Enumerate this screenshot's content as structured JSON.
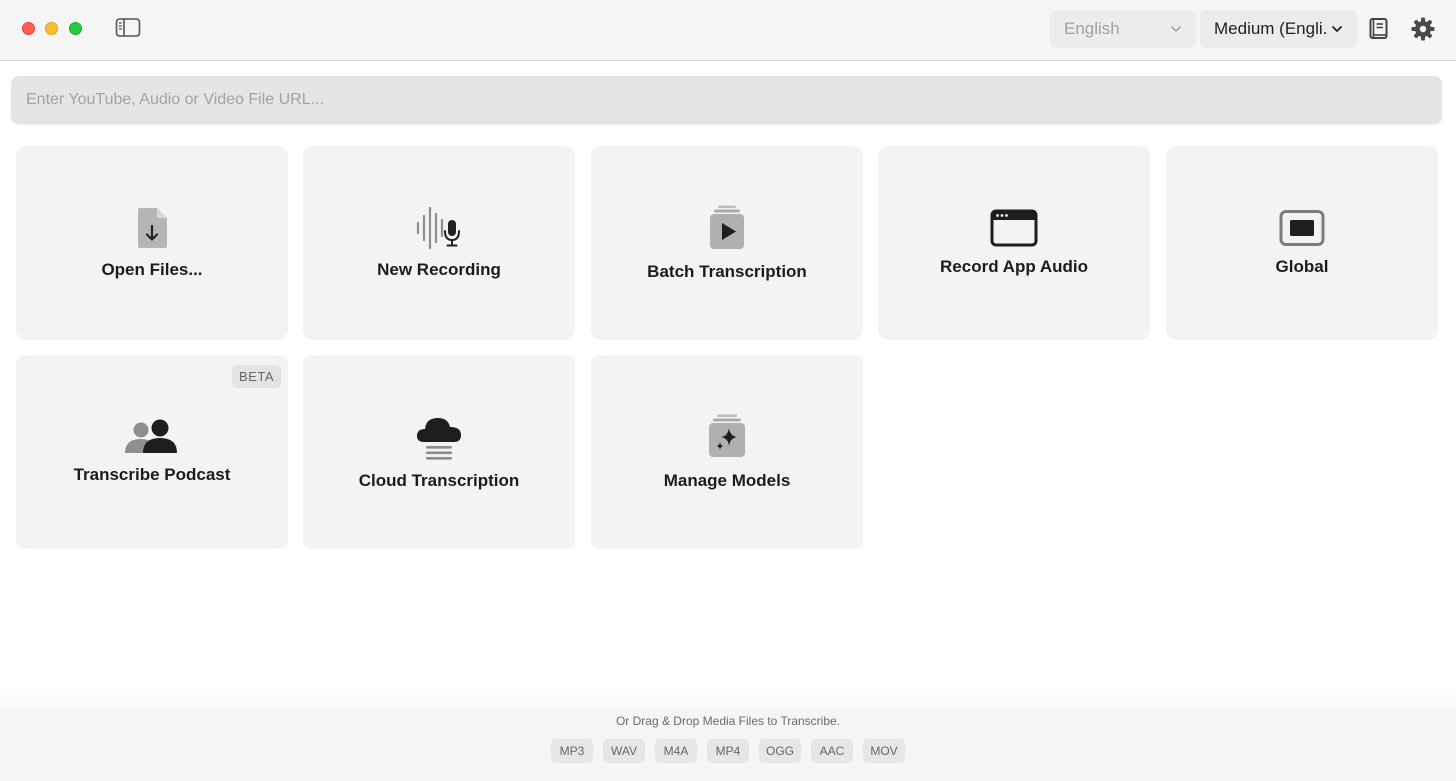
{
  "toolbar": {
    "language": "English",
    "model": "Medium (Engli...",
    "icons": [
      "sidebar-toggle-icon",
      "book-icon",
      "gear-icon"
    ]
  },
  "url_input": {
    "value": "",
    "placeholder": "Enter YouTube, Audio or Video File URL..."
  },
  "tiles": [
    {
      "label": "Open Files...",
      "icon": "file-download-icon"
    },
    {
      "label": "New Recording",
      "icon": "waveform-mic-icon"
    },
    {
      "label": "Batch Transcription",
      "icon": "play-stack-icon"
    },
    {
      "label": "Record App Audio",
      "icon": "app-window-icon"
    },
    {
      "label": "Global",
      "icon": "display-icon"
    },
    {
      "label": "Transcribe Podcast",
      "icon": "people-icon",
      "badge": "BETA"
    },
    {
      "label": "Cloud Transcription",
      "icon": "cloud-icon"
    },
    {
      "label": "Manage Models",
      "icon": "sparkle-stack-icon"
    }
  ],
  "footer": {
    "drop_text": "Or Drag & Drop Media Files to Transcribe.",
    "formats": [
      "MP3",
      "WAV",
      "M4A",
      "MP4",
      "OGG",
      "AAC",
      "MOV"
    ]
  },
  "colors": {
    "close": "#fe5f57",
    "minimize": "#febc2e",
    "maximize": "#28c840",
    "tile_bg": "#f3f3f3"
  }
}
